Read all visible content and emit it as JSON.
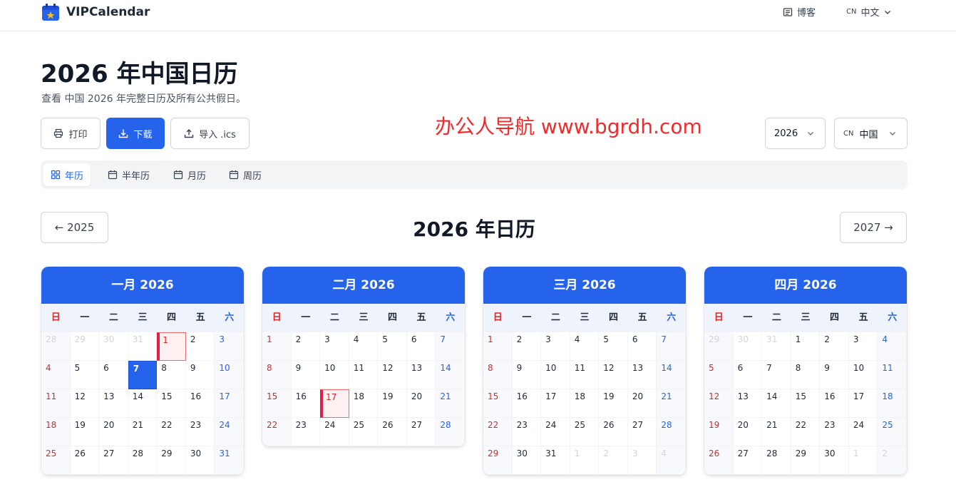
{
  "header": {
    "brand": "VIPCalendar",
    "blog_label": "博客",
    "lang_code": "CN",
    "lang_label": "中文"
  },
  "page": {
    "title": "2026 年中国日历",
    "subtitle": "查看 中国 2026 年完整日历及所有公共假日。"
  },
  "actions": {
    "print": "打印",
    "download": "下载",
    "import_ics": "导入 .ics"
  },
  "selects": {
    "year": "2026",
    "country_code": "CN",
    "country": "中国"
  },
  "watermark": "办公人导航  www.bgrdh.com",
  "tabs": [
    {
      "label": "年历"
    },
    {
      "label": "半年历"
    },
    {
      "label": "月历"
    },
    {
      "label": "周历"
    }
  ],
  "year_nav": {
    "prev": "← 2025",
    "title": "2026 年日历",
    "next": "2027 →"
  },
  "weekdays": [
    "日",
    "一",
    "二",
    "三",
    "四",
    "五",
    "六"
  ],
  "colors": {
    "accent": "#2563eb",
    "sunday": "#dc2626",
    "saturday": "#2563eb",
    "holiday": "#e11d48"
  },
  "months": [
    {
      "title": "一月 2026",
      "rows": [
        [
          "28",
          "29",
          "30",
          "31",
          "1",
          "2",
          "3"
        ],
        [
          "4",
          "5",
          "6",
          "7",
          "8",
          "9",
          "10"
        ],
        [
          "11",
          "12",
          "13",
          "14",
          "15",
          "16",
          "17"
        ],
        [
          "18",
          "19",
          "20",
          "21",
          "22",
          "23",
          "24"
        ],
        [
          "25",
          "26",
          "27",
          "28",
          "29",
          "30",
          "31"
        ]
      ],
      "leading_other": 4,
      "trailing_other": 0,
      "holidays": [
        "1"
      ],
      "today": "7"
    },
    {
      "title": "二月 2026",
      "rows": [
        [
          "1",
          "2",
          "3",
          "4",
          "5",
          "6",
          "7"
        ],
        [
          "8",
          "9",
          "10",
          "11",
          "12",
          "13",
          "14"
        ],
        [
          "15",
          "16",
          "17",
          "18",
          "19",
          "20",
          "21"
        ],
        [
          "22",
          "23",
          "24",
          "25",
          "26",
          "27",
          "28"
        ]
      ],
      "leading_other": 0,
      "trailing_other": 0,
      "holidays": [
        "17"
      ],
      "today": ""
    },
    {
      "title": "三月 2026",
      "rows": [
        [
          "1",
          "2",
          "3",
          "4",
          "5",
          "6",
          "7"
        ],
        [
          "8",
          "9",
          "10",
          "11",
          "12",
          "13",
          "14"
        ],
        [
          "15",
          "16",
          "17",
          "18",
          "19",
          "20",
          "21"
        ],
        [
          "22",
          "23",
          "24",
          "25",
          "26",
          "27",
          "28"
        ],
        [
          "29",
          "30",
          "31",
          "1",
          "2",
          "3",
          "4"
        ]
      ],
      "leading_other": 0,
      "trailing_other": 4,
      "holidays": [],
      "today": ""
    },
    {
      "title": "四月 2026",
      "rows": [
        [
          "29",
          "30",
          "31",
          "1",
          "2",
          "3",
          "4"
        ],
        [
          "5",
          "6",
          "7",
          "8",
          "9",
          "10",
          "11"
        ],
        [
          "12",
          "13",
          "14",
          "15",
          "16",
          "17",
          "18"
        ],
        [
          "19",
          "20",
          "21",
          "22",
          "23",
          "24",
          "25"
        ],
        [
          "26",
          "27",
          "28",
          "29",
          "30",
          "1",
          "2"
        ]
      ],
      "leading_other": 3,
      "trailing_other": 2,
      "holidays": [],
      "today": ""
    }
  ]
}
